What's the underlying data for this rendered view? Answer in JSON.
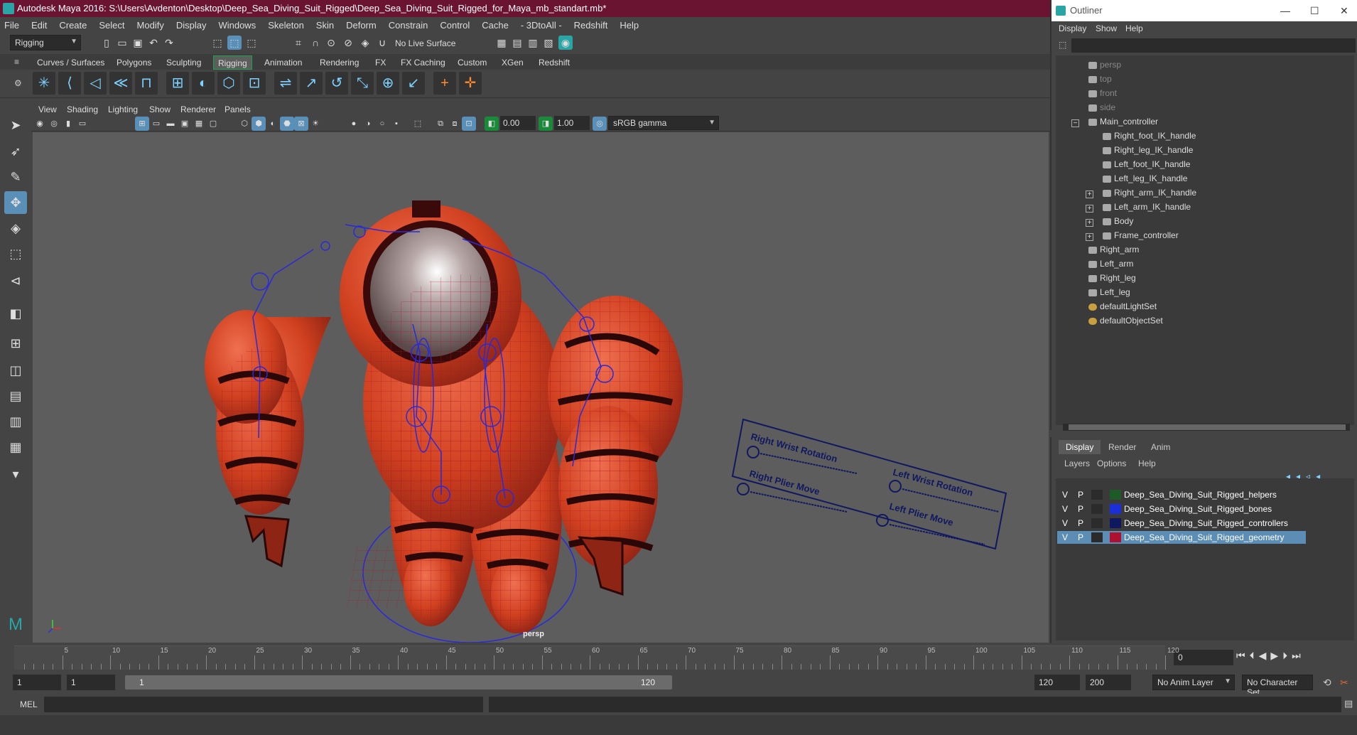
{
  "titlebar": {
    "title": "Autodesk Maya 2016: S:\\Users\\Avdenton\\Desktop\\Deep_Sea_Diving_Suit_Rigged\\Deep_Sea_Diving_Suit_Rigged_for_Maya_mb_standart.mb*"
  },
  "menubar": [
    "File",
    "Edit",
    "Create",
    "Select",
    "Modify",
    "Display",
    "Windows",
    "Skeleton",
    "Skin",
    "Deform",
    "Constrain",
    "Control",
    "Cache",
    "- 3DtoAll -",
    "Redshift",
    "Help"
  ],
  "statusline": {
    "mode": "Rigging",
    "live_surface": "No Live Surface"
  },
  "shelf_tabs": [
    "Curves / Surfaces",
    "Polygons",
    "Sculpting",
    "Rigging",
    "Animation",
    "Rendering",
    "FX",
    "FX Caching",
    "Custom",
    "XGen",
    "Redshift"
  ],
  "shelf_active": "Rigging",
  "panel_menu": [
    "View",
    "Shading",
    "Lighting",
    "Show",
    "Renderer",
    "Panels"
  ],
  "panel_toolbar": {
    "value1": "0.00",
    "value2": "1.00",
    "colorspace": "sRGB gamma"
  },
  "viewport": {
    "camera_label": "persp",
    "board_labels": [
      "Right Wrist Rotation",
      "Left Wrist Rotation",
      "Right Plier Move",
      "Left Plier Move"
    ]
  },
  "outliner": {
    "title": "Outliner",
    "menu": [
      "Display",
      "Show",
      "Help"
    ],
    "items": [
      {
        "label": "persp",
        "dim": true
      },
      {
        "label": "top",
        "dim": true
      },
      {
        "label": "front",
        "dim": true
      },
      {
        "label": "side",
        "dim": true
      },
      {
        "label": "Main_controller"
      },
      {
        "label": "Right_foot_IK_handle"
      },
      {
        "label": "Right_leg_IK_handle"
      },
      {
        "label": "Left_foot_IK_handle"
      },
      {
        "label": "Left_leg_IK_handle"
      },
      {
        "label": "Right_arm_IK_handle"
      },
      {
        "label": "Left_arm_IK_handle"
      },
      {
        "label": "Body"
      },
      {
        "label": "Frame_controller"
      },
      {
        "label": "Right_arm"
      },
      {
        "label": "Left_arm"
      },
      {
        "label": "Right_leg"
      },
      {
        "label": "Left_leg"
      },
      {
        "label": "defaultLightSet"
      },
      {
        "label": "defaultObjectSet"
      }
    ]
  },
  "layer_editor": {
    "tabs": [
      "Display",
      "Render",
      "Anim"
    ],
    "menu": [
      "Layers",
      "Options",
      "Help"
    ],
    "layers": [
      {
        "v": "V",
        "p": "P",
        "name": "Deep_Sea_Diving_Suit_Rigged_helpers",
        "color": "#1e5a28",
        "selected": false
      },
      {
        "v": "V",
        "p": "P",
        "name": "Deep_Sea_Diving_Suit_Rigged_bones",
        "color": "#1a2fd8",
        "selected": false
      },
      {
        "v": "V",
        "p": "P",
        "name": "Deep_Sea_Diving_Suit_Rigged_controllers",
        "color": "#101860",
        "selected": false
      },
      {
        "v": "V",
        "p": "P",
        "name": "Deep_Sea_Diving_Suit_Rigged_geometry",
        "color": "#b01030",
        "selected": true
      }
    ]
  },
  "timeline": {
    "ticks": [
      "5",
      "10",
      "15",
      "20",
      "25",
      "30",
      "35",
      "40",
      "45",
      "50",
      "55",
      "60",
      "65",
      "70",
      "75",
      "80",
      "85",
      "90",
      "95",
      "100",
      "105",
      "110",
      "115",
      "120"
    ],
    "current_frame": "0"
  },
  "range": {
    "start": "1",
    "start2": "1",
    "slider_start": "1",
    "slider_end": "120",
    "end": "120",
    "end2": "200",
    "anim_layer": "No Anim Layer",
    "char_set": "No Character Set"
  },
  "cmdline": {
    "label": "MEL"
  },
  "colors": {
    "title_bg": "#6b1432",
    "accent": "#5a8fb8",
    "mesh": "#d24a2a",
    "wire": "#c0102a",
    "bones": "#2a2ad8"
  }
}
